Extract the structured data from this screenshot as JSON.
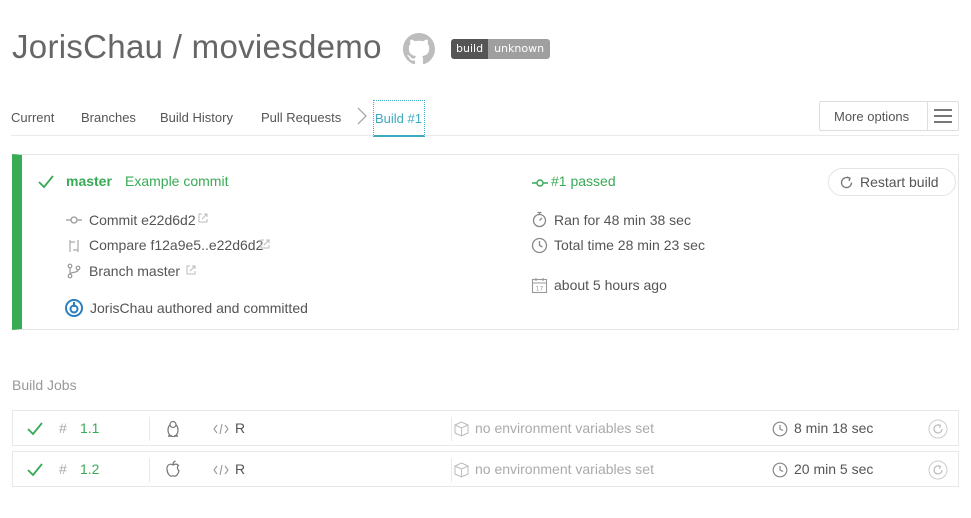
{
  "header": {
    "repo_title": "JorisChau / moviesdemo",
    "badge_left": "build",
    "badge_right": "unknown"
  },
  "tabs": {
    "current": "Current",
    "branches": "Branches",
    "build_history": "Build History",
    "pull_requests": "Pull Requests",
    "active": "Build #1",
    "more_options": "More options"
  },
  "build": {
    "branch": "master",
    "commit_message": "Example commit",
    "commit": "Commit e22d6d2",
    "compare": "Compare f12a9e5..e22d6d2",
    "branch_line": "Branch master",
    "author": "JorisChau authored and committed",
    "status": "#1 passed",
    "ran_for": "Ran for 48 min 38 sec",
    "total_time": "Total time 28 min 23 sec",
    "date": "about 5 hours ago",
    "calendar_day": "17",
    "restart": "Restart build",
    "accent": "#39aa56"
  },
  "jobs": {
    "title": "Build Jobs",
    "rows": [
      {
        "number": "1.1",
        "os_icon": "linux-icon",
        "language": "R",
        "env": "no environment variables set",
        "duration": "8 min 18 sec"
      },
      {
        "number": "1.2",
        "os_icon": "apple-icon",
        "language": "R",
        "env": "no environment variables set",
        "duration": "20 min 5 sec"
      }
    ]
  }
}
